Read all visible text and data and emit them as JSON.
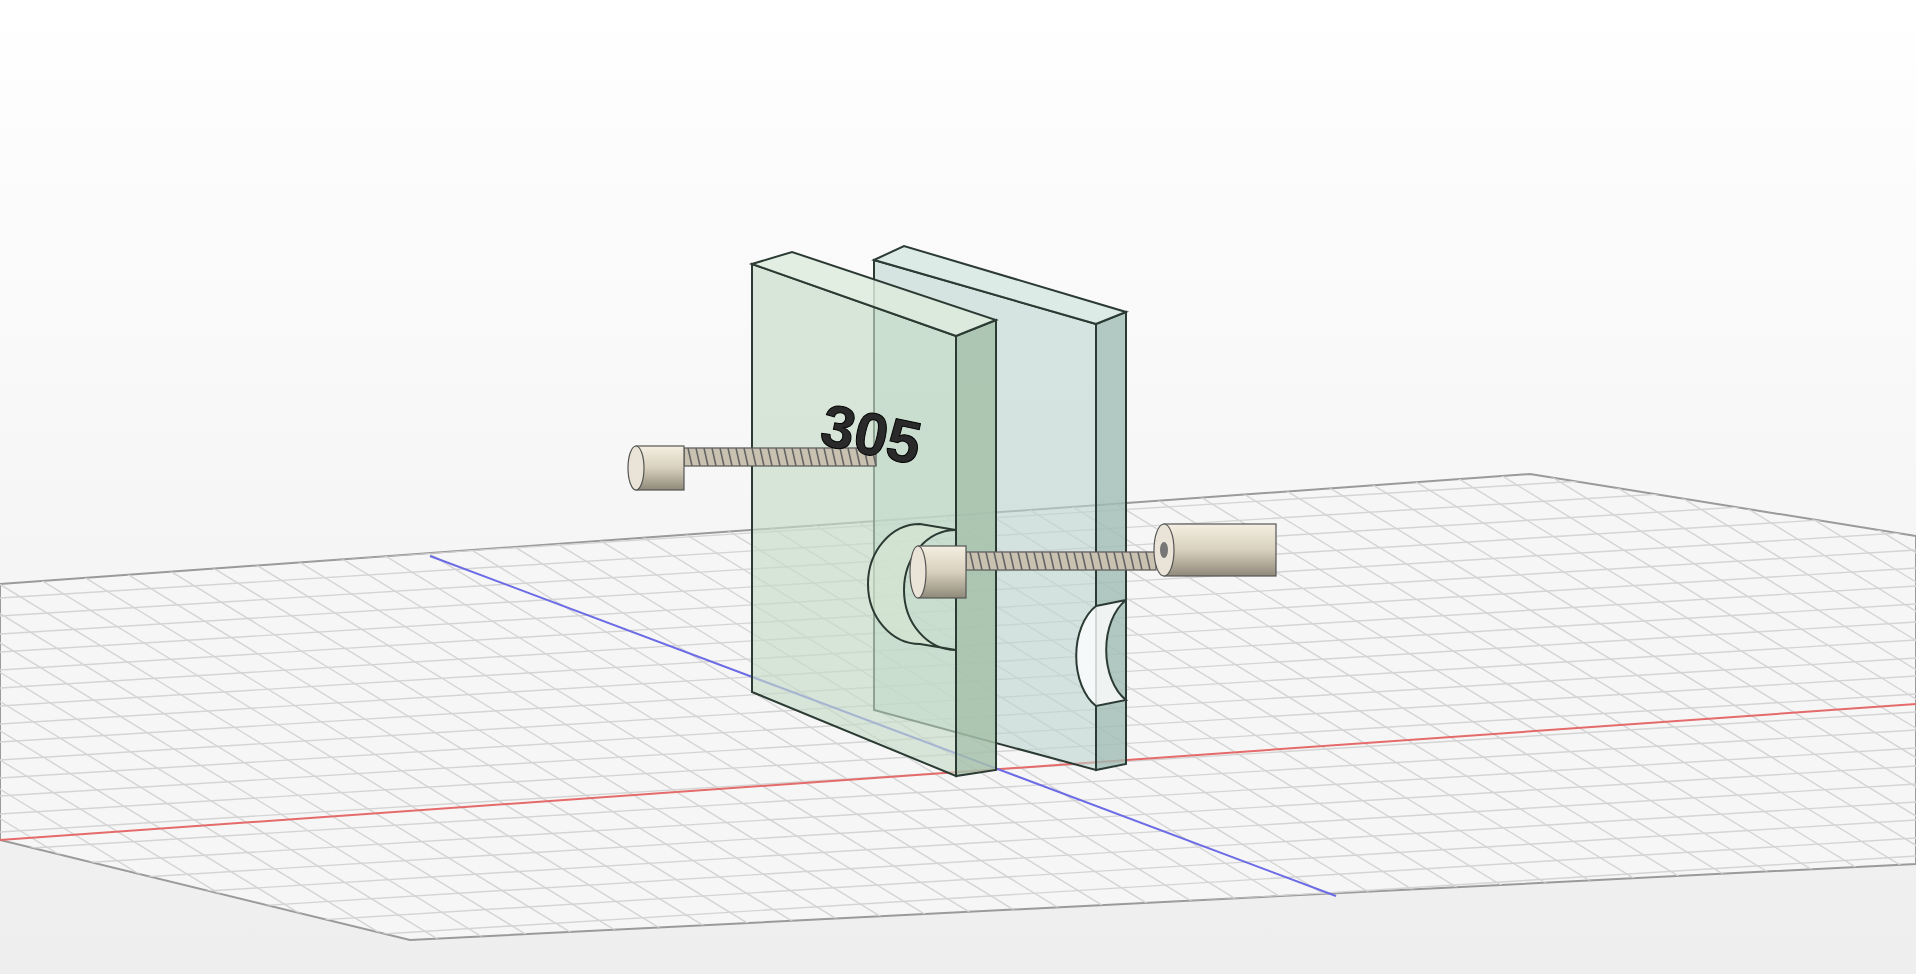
{
  "viewport": {
    "model_label": "305"
  }
}
